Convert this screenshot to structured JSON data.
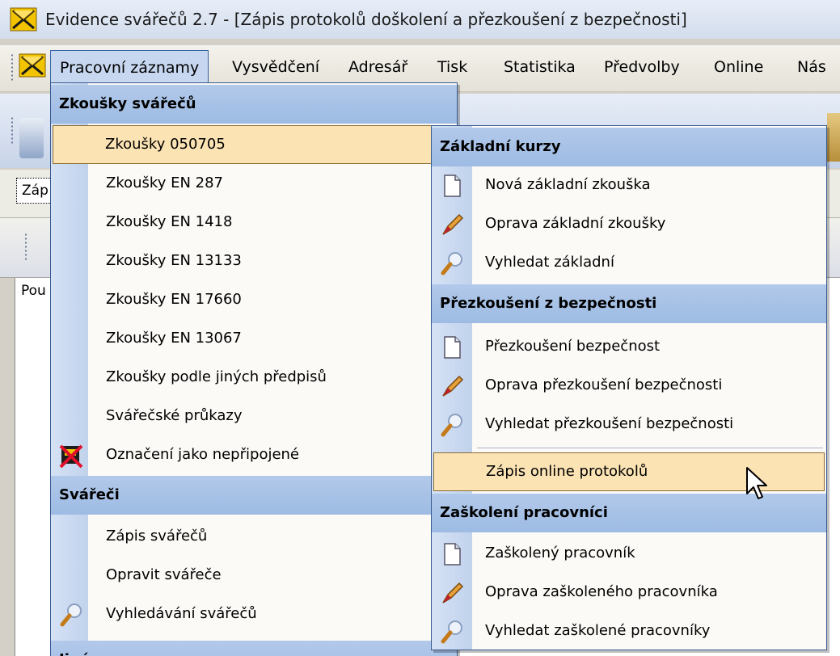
{
  "window": {
    "title": "Evidence svářečů 2.7 - [Zápis protokolů doškolení a přezkoušení z bezpečnosti]"
  },
  "menubar": {
    "items": [
      "Pracovní záznamy",
      "Vysvědčení",
      "Adresář",
      "Tisk",
      "Statistika",
      "Předvolby",
      "Online",
      "Nás"
    ]
  },
  "background": {
    "tab_fragment": "Záp",
    "column_fragment": "Pou"
  },
  "main_menu": {
    "sections": [
      {
        "header": "Zkoušky svářečů",
        "items": [
          {
            "label": "Zkoušky 050705",
            "submenu": true,
            "highlighted": true
          },
          {
            "label": "Zkoušky EN 287",
            "submenu": true
          },
          {
            "label": "Zkoušky EN 1418",
            "submenu": true
          },
          {
            "label": "Zkoušky EN 13133",
            "submenu": true
          },
          {
            "label": "Zkoušky EN 17660",
            "submenu": true
          },
          {
            "label": "Zkoušky EN 13067",
            "submenu": true
          },
          {
            "label": "Zkoušky podle jiných předpisů",
            "submenu": true
          },
          {
            "label": "Svářečské průkazy",
            "submenu": true
          },
          {
            "label": "Označení jako nepřipojené",
            "icon": "disconnected-icon"
          }
        ]
      },
      {
        "header": "Svářeči",
        "items": [
          {
            "label": "Zápis svářečů"
          },
          {
            "label": "Opravit svářeče"
          },
          {
            "label": "Vyhledávání svářečů",
            "icon": "search-icon"
          }
        ]
      },
      {
        "header": "Jiné",
        "items": []
      }
    ]
  },
  "submenu": {
    "sections": [
      {
        "header": "Základní kurzy",
        "items": [
          {
            "label": "Nová základní zkouška",
            "icon": "new-document-icon"
          },
          {
            "label": "Oprava základní zkoušky",
            "icon": "edit-icon"
          },
          {
            "label": "Vyhledat základní",
            "icon": "search-icon"
          }
        ]
      },
      {
        "header": "Přezkoušení z bezpečnosti",
        "items": [
          {
            "label": "Přezkoušení bezpečnost",
            "icon": "new-document-icon"
          },
          {
            "label": "Oprava přezkoušení bezpečnosti",
            "icon": "edit-icon"
          },
          {
            "label": "Vyhledat přezkoušení bezpečnosti",
            "icon": "search-icon"
          },
          {
            "label": "Zápis online protokolů",
            "highlighted": true
          }
        ]
      },
      {
        "header": "Zaškolení pracovníci",
        "items": [
          {
            "label": "Zaškolený pracovník",
            "icon": "new-document-icon"
          },
          {
            "label": "Oprava zaškoleného pracovníka",
            "icon": "edit-icon"
          },
          {
            "label": "Vyhledat zaškolené pracovníky",
            "icon": "search-icon"
          }
        ]
      }
    ]
  },
  "colors": {
    "menu_header": "#a8c3e8",
    "highlight": "#fbe3b4",
    "highlight_border": "#8a6b32",
    "gutter": "#c9d8ef"
  }
}
